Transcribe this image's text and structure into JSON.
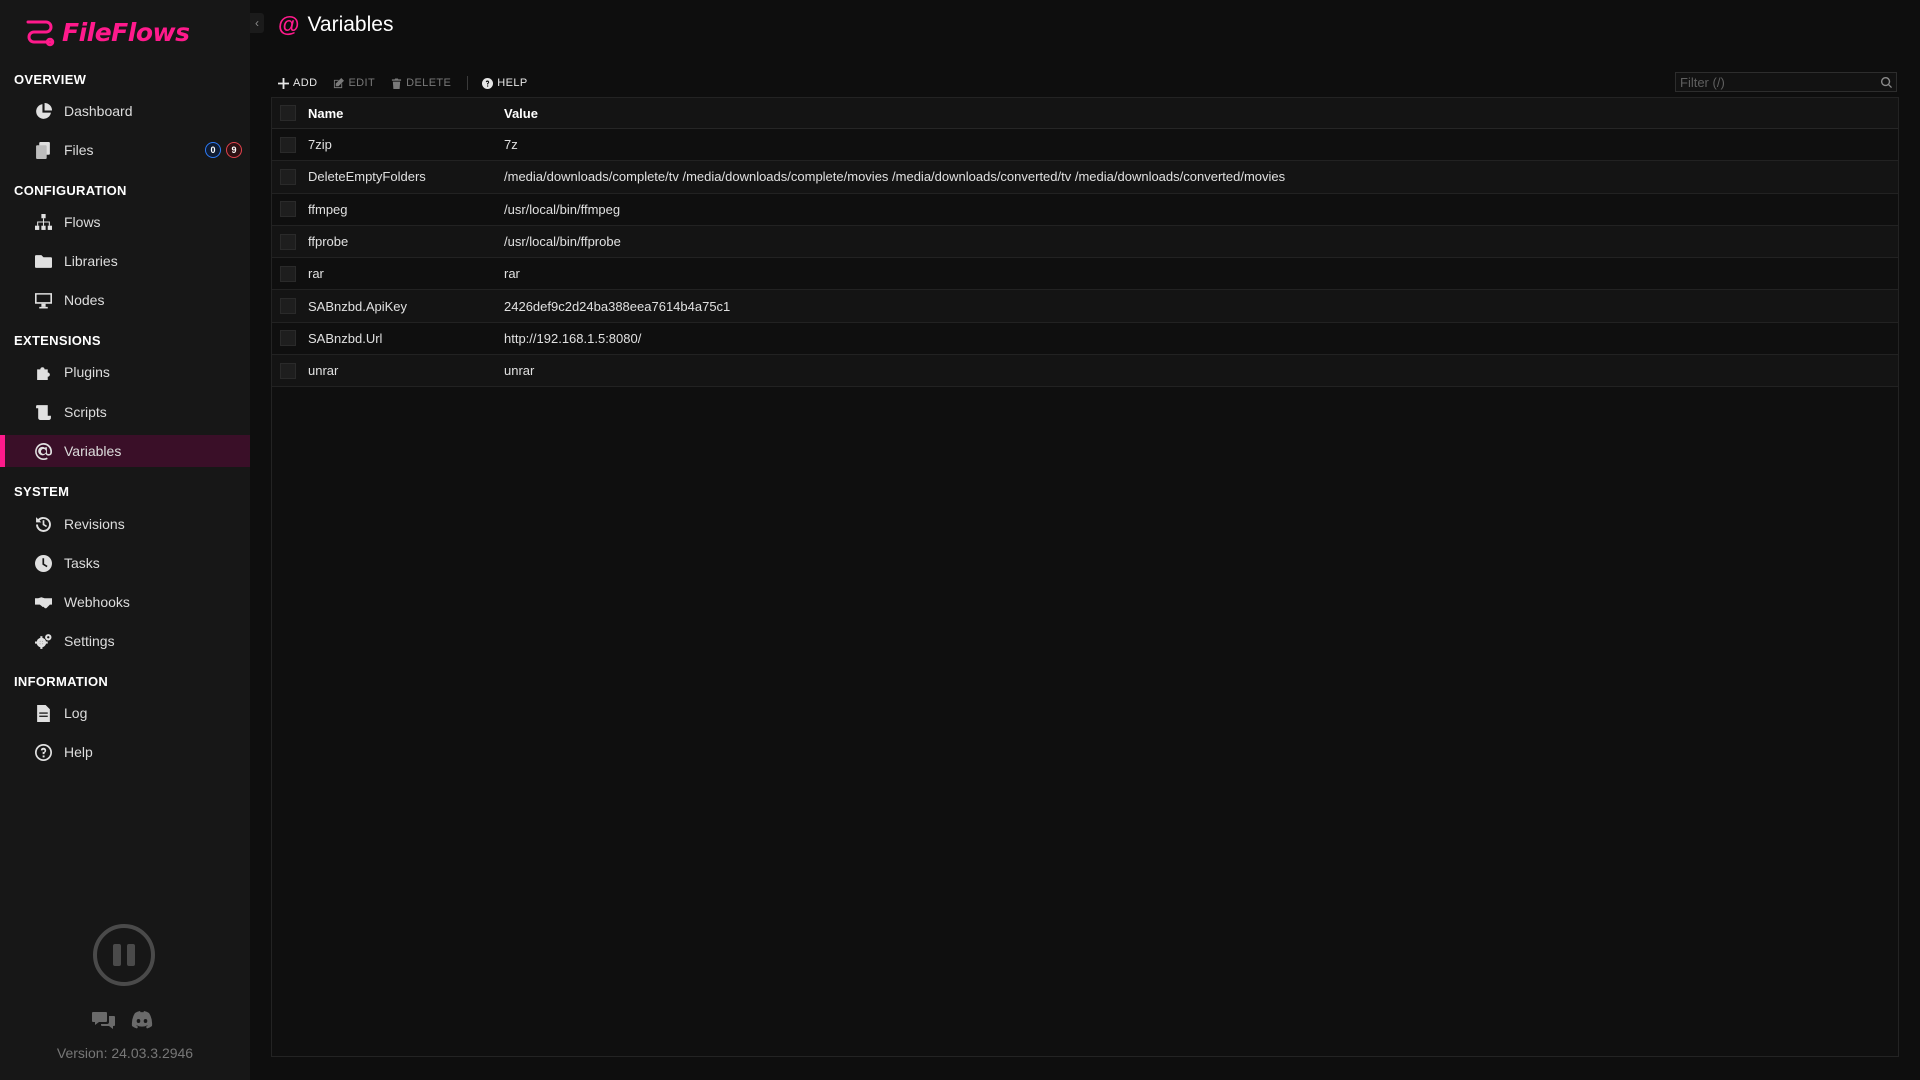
{
  "app": {
    "name": "FileFlows",
    "version": "Version: 24.03.3.2946",
    "brand_color": "#ff1a8c"
  },
  "sidebar": {
    "collapse_icon": "chevron-left-icon",
    "sections": [
      {
        "title": "OVERVIEW",
        "items": [
          {
            "label": "Dashboard",
            "icon": "pie-chart-icon"
          },
          {
            "label": "Files",
            "icon": "files-icon",
            "badges": [
              "0",
              "9"
            ]
          }
        ]
      },
      {
        "title": "CONFIGURATION",
        "items": [
          {
            "label": "Flows",
            "icon": "sitemap-icon"
          },
          {
            "label": "Libraries",
            "icon": "folder-icon"
          },
          {
            "label": "Nodes",
            "icon": "desktop-icon"
          }
        ]
      },
      {
        "title": "EXTENSIONS",
        "items": [
          {
            "label": "Plugins",
            "icon": "puzzle-icon"
          },
          {
            "label": "Scripts",
            "icon": "scroll-icon"
          },
          {
            "label": "Variables",
            "icon": "at-icon",
            "active": true
          }
        ]
      },
      {
        "title": "SYSTEM",
        "items": [
          {
            "label": "Revisions",
            "icon": "history-icon"
          },
          {
            "label": "Tasks",
            "icon": "clock-icon"
          },
          {
            "label": "Webhooks",
            "icon": "handshake-icon"
          },
          {
            "label": "Settings",
            "icon": "cogs-icon"
          }
        ]
      },
      {
        "title": "INFORMATION",
        "items": [
          {
            "label": "Log",
            "icon": "file-icon"
          },
          {
            "label": "Help",
            "icon": "question-circle-icon"
          }
        ]
      }
    ]
  },
  "page": {
    "title_icon": "@",
    "title": "Variables"
  },
  "toolbar": {
    "add": "ADD",
    "edit": "EDIT",
    "delete": "DELETE",
    "help": "HELP"
  },
  "filter": {
    "placeholder": "Filter (/)"
  },
  "table": {
    "columns": [
      "Name",
      "Value"
    ],
    "rows": [
      {
        "name": "7zip",
        "value": "7z"
      },
      {
        "name": "DeleteEmptyFolders",
        "value": "/media/downloads/complete/tv /media/downloads/complete/movies /media/downloads/converted/tv /media/downloads/converted/movies"
      },
      {
        "name": "ffmpeg",
        "value": "/usr/local/bin/ffmpeg"
      },
      {
        "name": "ffprobe",
        "value": "/usr/local/bin/ffprobe"
      },
      {
        "name": "rar",
        "value": "rar"
      },
      {
        "name": "SABnzbd.ApiKey",
        "value": "2426def9c2d24ba388eea7614b4a75c1"
      },
      {
        "name": "SABnzbd.Url",
        "value": "http://192.168.1.5:8080/"
      },
      {
        "name": "unrar",
        "value": "unrar"
      }
    ]
  }
}
